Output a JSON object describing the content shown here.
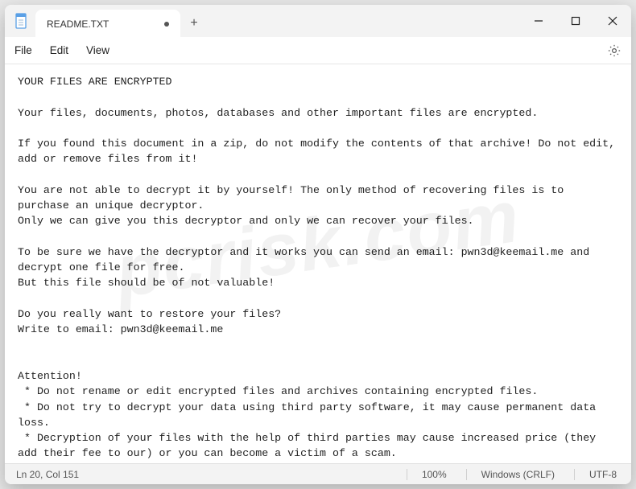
{
  "titlebar": {
    "tab_title": "README.TXT",
    "new_tab_label": "+"
  },
  "menubar": {
    "file": "File",
    "edit": "Edit",
    "view": "View"
  },
  "editor": {
    "text": "YOUR FILES ARE ENCRYPTED\n\nYour files, documents, photos, databases and other important files are encrypted.\n\nIf you found this document in a zip, do not modify the contents of that archive! Do not edit, add or remove files from it!\n\nYou are not able to decrypt it by yourself! The only method of recovering files is to purchase an unique decryptor.\nOnly we can give you this decryptor and only we can recover your files.\n\nTo be sure we have the decryptor and it works you can send an email: pwn3d@keemail.me and decrypt one file for free.\nBut this file should be of not valuable!\n\nDo you really want to restore your files?\nWrite to email: pwn3d@keemail.me\n\n\nAttention!\n * Do not rename or edit encrypted files and archives containing encrypted files.\n * Do not try to decrypt your data using third party software, it may cause permanent data loss.\n * Decryption of your files with the help of third parties may cause increased price (they add their fee to our) or you can become a victim of a scam."
  },
  "statusbar": {
    "cursor": "Ln 20, Col 151",
    "zoom": "100%",
    "eol": "Windows (CRLF)",
    "encoding": "UTF-8"
  },
  "watermark": "pcrisk.com"
}
